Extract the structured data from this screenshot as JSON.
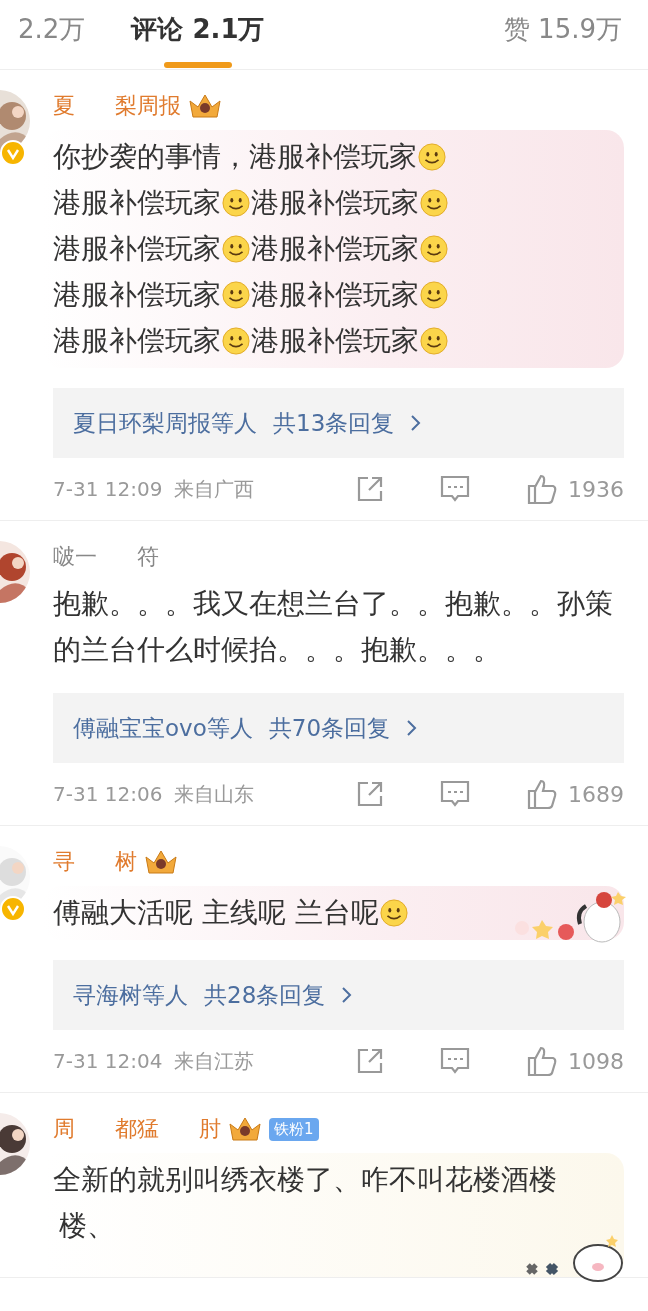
{
  "tabs": [
    {
      "label": "2.2万",
      "selected": false
    },
    {
      "label": "评论 2.1万",
      "selected": true
    },
    {
      "label": "赞 15.9万",
      "selected": false
    }
  ],
  "comments": [
    {
      "name_parts": [
        "夏",
        "梨周报"
      ],
      "vip": true,
      "crown": true,
      "verified": true,
      "bubble": {
        "kind": "pink"
      },
      "text": [
        {
          "kind": "text",
          "text": "你抄袭的事情，港服补偿玩家"
        },
        {
          "kind": "emoji"
        },
        {
          "kind": "text",
          "text": "港服补偿玩家"
        },
        {
          "kind": "emoji"
        },
        {
          "kind": "text",
          "text": "港服补偿玩家"
        },
        {
          "kind": "emoji"
        },
        {
          "kind": "text",
          "text": "港服补偿玩家"
        },
        {
          "kind": "emoji"
        },
        {
          "kind": "text",
          "text": "港服补偿玩家"
        },
        {
          "kind": "emoji"
        },
        {
          "kind": "text",
          "text": "港服补偿玩家"
        },
        {
          "kind": "emoji"
        },
        {
          "kind": "text",
          "text": "港服补偿玩家"
        },
        {
          "kind": "emoji"
        },
        {
          "kind": "text",
          "text": "港服补偿玩家"
        },
        {
          "kind": "emoji"
        },
        {
          "kind": "text",
          "text": "港服补偿玩家"
        },
        {
          "kind": "emoji"
        }
      ],
      "replies": {
        "who": "夏日环梨周报等人",
        "count": "共13条回复"
      },
      "time": "7-31 12:09",
      "location": "来自广西",
      "likes": "1936"
    },
    {
      "name_parts": [
        "啵一",
        "符"
      ],
      "vip": false,
      "crown": false,
      "verified": false,
      "text": [
        {
          "kind": "text",
          "text": "抱歉。。。我又在想兰台了。。抱歉。。孙策的兰台什么时候抬。。。抱歉。。。"
        }
      ],
      "replies": {
        "who": "傅融宝宝ovo等人",
        "count": "共70条回复"
      },
      "time": "7-31 12:06",
      "location": "来自山东",
      "likes": "1689"
    },
    {
      "name_parts": [
        "寻",
        "树"
      ],
      "vip": true,
      "crown": true,
      "verified": true,
      "bubble": {
        "kind": "pink"
      },
      "sticker": {
        "kind": "puppy"
      },
      "text": [
        {
          "kind": "text",
          "text": "傅融大活呢 主线呢 兰台呢"
        },
        {
          "kind": "emoji"
        }
      ],
      "replies": {
        "who": "寻海树等人",
        "count": "共28条回复"
      },
      "time": "7-31 12:04",
      "location": "来自江苏",
      "likes": "1098"
    },
    {
      "name_parts": [
        "周",
        "都猛",
        "肘"
      ],
      "vip": true,
      "crown": true,
      "verified": false,
      "fan_badge": "铁粉1",
      "bubble": {
        "kind": "cream"
      },
      "sticker": {
        "kind": "pig"
      },
      "text": [
        {
          "kind": "text",
          "text": "全新的就别叫绣衣楼了、咋不叫花楼酒楼"
        },
        {
          "kind": "text",
          "text": "楼、"
        }
      ]
    }
  ]
}
